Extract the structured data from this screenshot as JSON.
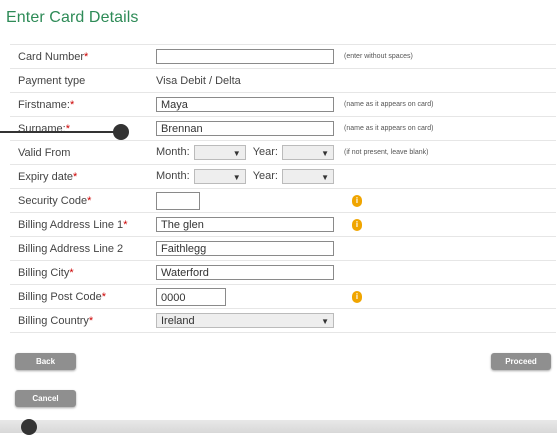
{
  "page_title": "Enter Card Details",
  "required_marker": "*",
  "fields": {
    "card_number": {
      "label": "Card Number",
      "value": "",
      "hint": "(enter without spaces)"
    },
    "payment_type": {
      "label": "Payment type",
      "value": "Visa Debit / Delta"
    },
    "firstname": {
      "label": "Firstname:",
      "value": "Maya",
      "hint": "(name as it appears on card)"
    },
    "surname": {
      "label": "Surname:",
      "value": "Brennan",
      "hint": "(name as it appears on card)"
    },
    "valid_from": {
      "label": "Valid From",
      "month_label": "Month:",
      "year_label": "Year:",
      "month_value": "",
      "year_value": "",
      "hint": "(if not present, leave blank)"
    },
    "expiry_date": {
      "label": "Expiry date",
      "month_label": "Month:",
      "year_label": "Year:",
      "month_value": "",
      "year_value": ""
    },
    "security_code": {
      "label": "Security Code",
      "value": ""
    },
    "billing_address_1": {
      "label": "Billing Address Line 1",
      "value": "The glen"
    },
    "billing_address_2": {
      "label": "Billing Address Line 2",
      "value": "Faithlegg"
    },
    "billing_city": {
      "label": "Billing City",
      "value": "Waterford"
    },
    "billing_post_code": {
      "label": "Billing Post Code",
      "value": "0000"
    },
    "billing_country": {
      "label": "Billing Country",
      "value": "Ireland"
    }
  },
  "buttons": {
    "back": "Back",
    "proceed": "Proceed",
    "cancel": "Cancel"
  },
  "icons": {
    "info": "info-icon",
    "dropdown": "chevron-down-icon"
  },
  "colors": {
    "title": "#2e8b57",
    "required": "#cc0000",
    "button": "#8f8f8f",
    "info": "#f0a500"
  }
}
